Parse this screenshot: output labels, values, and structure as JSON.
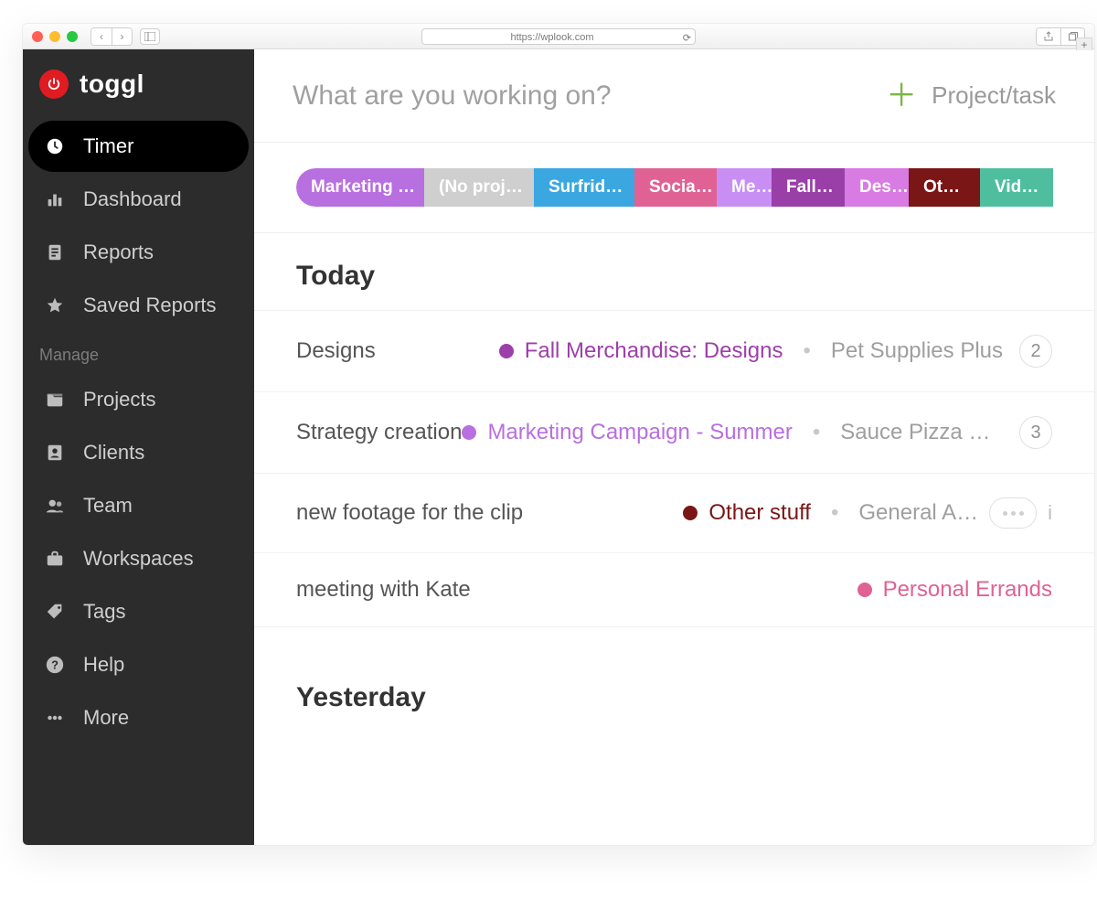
{
  "browser": {
    "url": "https://wplook.com"
  },
  "brand": {
    "text": "toggl"
  },
  "sidebar": {
    "nav": [
      {
        "label": "Timer",
        "icon": "clock",
        "active": true
      },
      {
        "label": "Dashboard",
        "icon": "bars",
        "active": false
      },
      {
        "label": "Reports",
        "icon": "doc",
        "active": false
      },
      {
        "label": "Saved Reports",
        "icon": "star",
        "active": false
      }
    ],
    "manage_heading": "Manage",
    "manage": [
      {
        "label": "Projects",
        "icon": "folder"
      },
      {
        "label": "Clients",
        "icon": "person"
      },
      {
        "label": "Team",
        "icon": "people"
      },
      {
        "label": "Workspaces",
        "icon": "briefcase"
      },
      {
        "label": "Tags",
        "icon": "tag"
      },
      {
        "label": "Help",
        "icon": "help"
      },
      {
        "label": "More",
        "icon": "more"
      }
    ]
  },
  "topbar": {
    "placeholder": "What are you working on?",
    "project_task": "Project/task"
  },
  "pills": [
    {
      "label": "Marketing …",
      "color": "#b86fe0",
      "width": 140
    },
    {
      "label": "(No proj…",
      "color": "#cfcfcf",
      "width": 120
    },
    {
      "label": "Surfrid…",
      "color": "#3aa7e0",
      "width": 110
    },
    {
      "label": "Socia…",
      "color": "#e06294",
      "width": 90
    },
    {
      "label": "Me…",
      "color": "#c98ef4",
      "width": 60
    },
    {
      "label": "Fall…",
      "color": "#9a3fa8",
      "width": 80
    },
    {
      "label": "Des…",
      "color": "#d87be2",
      "width": 70
    },
    {
      "label": "Ot…",
      "color": "#7a1616",
      "width": 78
    },
    {
      "label": "Vid…",
      "color": "#4fbe9f",
      "width": 80
    }
  ],
  "today_heading": "Today",
  "yesterday_heading": "Yesterday",
  "colors": {
    "fall": "#9d3fa9",
    "marketing": "#b86fe0",
    "other": "#7a1616",
    "personal": "#e06294"
  },
  "entries_today": [
    {
      "title": "Designs",
      "project": "Fall Merchandise: Designs",
      "color_key": "fall",
      "client": "Pet Supplies Plus",
      "badge": "2",
      "trailing": ""
    },
    {
      "title": "Strategy creation",
      "project": "Marketing Campaign - Summer",
      "color_key": "marketing",
      "client": "Sauce Pizza P…",
      "badge": "3",
      "trailing": ""
    },
    {
      "title": "new footage for the clip",
      "project": "Other stuff",
      "color_key": "other",
      "client": "General A…",
      "badge": "more",
      "trailing": "i"
    },
    {
      "title": "meeting with Kate",
      "project": "Personal Errands",
      "color_key": "personal",
      "client": "",
      "badge": "",
      "trailing": ""
    }
  ]
}
